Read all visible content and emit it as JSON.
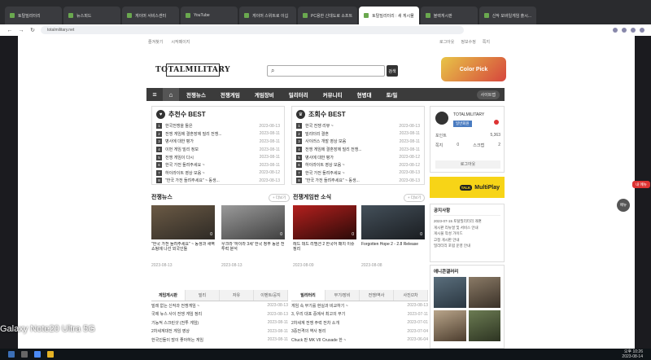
{
  "browser": {
    "tabs": [
      {
        "label": "토탈밀리터리",
        "active": false
      },
      {
        "label": "뉴스피드",
        "active": false
      },
      {
        "label": "게이머 서비스센터",
        "active": false
      },
      {
        "label": "YouTube",
        "active": false
      },
      {
        "label": "게이머 스위트로 이십",
        "active": false
      },
      {
        "label": "PC용한 신데도로 소프트",
        "active": false
      },
      {
        "label": "토탈밀리터리 : 새 게시물",
        "active": true
      },
      {
        "label": "블랙게시판",
        "active": false
      },
      {
        "label": "신작 모바일게임 출시...",
        "active": false
      }
    ],
    "url": "totalmilitary.net"
  },
  "util": {
    "links": [
      "즐겨찾기",
      "시작페이지"
    ],
    "right": [
      "로그아웃",
      "정보수정",
      "쪽지"
    ]
  },
  "header": {
    "logo_text": "TOTALMILITARY",
    "search_placeholder": "",
    "search_button": "검색",
    "banner_text": "Color Pick"
  },
  "gnb": {
    "items": [
      "전쟁뉴스",
      "전쟁게임",
      "게임장비",
      "밀리터리",
      "커뮤니티",
      "현병대",
      "토/밀"
    ],
    "right_label": "사이트맵"
  },
  "best_recommend": {
    "title": "추천수 BEST",
    "rows": [
      {
        "t": "한국전쟁을 들은",
        "d": "2023-08-13"
      },
      {
        "t": "전쟁 게임에 결혼장에 밀리 전쟁...",
        "d": "2023-08-11"
      },
      {
        "t": "병사에 대한 평가",
        "d": "2023-08-11"
      },
      {
        "t": "이번 게임 밀리 정보",
        "d": "2023-08-11"
      },
      {
        "t": "전쟁 게임이 다시",
        "d": "2023-08-11"
      },
      {
        "t": "한국 가전 들려주세요 ~",
        "d": "2023-08-11"
      },
      {
        "t": "하이라이트 영상 모음 ~",
        "d": "2023-08-12"
      },
      {
        "t": "\"한국 가전 들려주세요\" ~ 동생...",
        "d": "2023-08-13"
      }
    ]
  },
  "best_views": {
    "title": "조회수 BEST",
    "rows": [
      {
        "t": "한국 전쟁 리뷰 ~",
        "d": "2023-08-13"
      },
      {
        "t": "밀리터리 결혼",
        "d": "2023-08-11"
      },
      {
        "t": "사이러스 개발 영상 모음",
        "d": "2023-08-11"
      },
      {
        "t": "전쟁 게임에 결혼장에 밀리 전쟁...",
        "d": "2023-08-11"
      },
      {
        "t": "병사에 대한 평가",
        "d": "2023-08-12"
      },
      {
        "t": "하이라이트 영상 모음 ~",
        "d": "2023-08-12"
      },
      {
        "t": "한국 가전 들려주세요 ~",
        "d": "2023-08-13"
      },
      {
        "t": "\"한국 가전 들려주세요\" ~ 동생...",
        "d": "2023-08-13"
      }
    ]
  },
  "news": {
    "title": "전쟁뉴스",
    "more": "+ 더보기",
    "cards": [
      {
        "title": "\"한국 가전 들려주세요\" ~ 동생과 새벽 쇼핑에 나선 외국인들",
        "date": "2023-08-13",
        "cnt": "0"
      },
      {
        "title": "우크라 '하이라 3세' 한국 정부 동원 전투력 분석",
        "date": "2023-08-13",
        "cnt": "0"
      }
    ]
  },
  "game_news": {
    "title": "전쟁게임판 소식",
    "more": "+ 더보기",
    "cards": [
      {
        "title": "레드 데드 리뎀션 2 한국어 패치 이슈 정리",
        "date": "2023-08-09",
        "cnt": "0"
      },
      {
        "title": "Forgotten Hope 2 - 2.8 Release",
        "date": "2023-08-08",
        "cnt": "0"
      }
    ]
  },
  "tabs_left": {
    "heads": [
      "게임게시판",
      "밀리",
      "자유",
      "이벤트/공지"
    ],
    "rows": [
      {
        "t": "밀레 없는 신작과 전쟁게임 ~",
        "d": "2023-08-13"
      },
      {
        "t": "국제 뉴스 사이 전쟁 게임 정리",
        "d": "2023-08-13"
      },
      {
        "t": "기능적 스크린샷 (전투 게임)",
        "d": "2023-08-11"
      },
      {
        "t": "2차세계대전 게임 영상",
        "d": "2023-08-11"
      },
      {
        "t": "한국인들이 많이 좋아하는 게임",
        "d": "2023-08-11"
      }
    ]
  },
  "tabs_right": {
    "heads": [
      "밀리터리",
      "무기/장비",
      "전쟁/역사",
      "사진/2차"
    ],
    "rows": [
      {
        "t": "게임 속 무기를 현실과 비교하기 ~",
        "d": "2023-08-13"
      },
      {
        "t": "3, 우리 대포 중에서 최고의 무기",
        "d": "2023-07-11"
      },
      {
        "t": "2차세계 전쟁 주력 전차 소개",
        "d": "2023-07-01"
      },
      {
        "t": "3중전격의 역사 정리",
        "d": "2023-07-04"
      },
      {
        "t": "Chuck 판 MK VII Crusade 한 ~",
        "d": "2023-06-04"
      }
    ]
  },
  "login": {
    "nick": "TOTALMILITARY",
    "level": "일반회원",
    "stat1": {
      "label": "포인트",
      "value": "5,363"
    },
    "stat2": {
      "label": "쪽지",
      "value": "0"
    },
    "stat3": {
      "label": "스크랩",
      "value": "2"
    },
    "logout": "로그아웃"
  },
  "multiplay": {
    "talk": "TALK",
    "label": "MultiPlay"
  },
  "notice": {
    "title": "공지사항",
    "rows": [
      "2023-07-15 토탈밀리터리 개편",
      "게시판 리뉴얼 및 서비스 안내",
      "게시물 작성 가이드",
      "고정 게시판 안내",
      "밀리터리 포럼 운영 안내"
    ]
  },
  "gallery": {
    "title": "에니콘갤러리"
  },
  "side": {
    "red_btn": "내 메뉴",
    "round_btn": "메뉴"
  },
  "os": {
    "watermark": "Galaxy Note20 Ultra 5G",
    "clock_time": "오후 10:26",
    "clock_date": "2023-08-14"
  }
}
